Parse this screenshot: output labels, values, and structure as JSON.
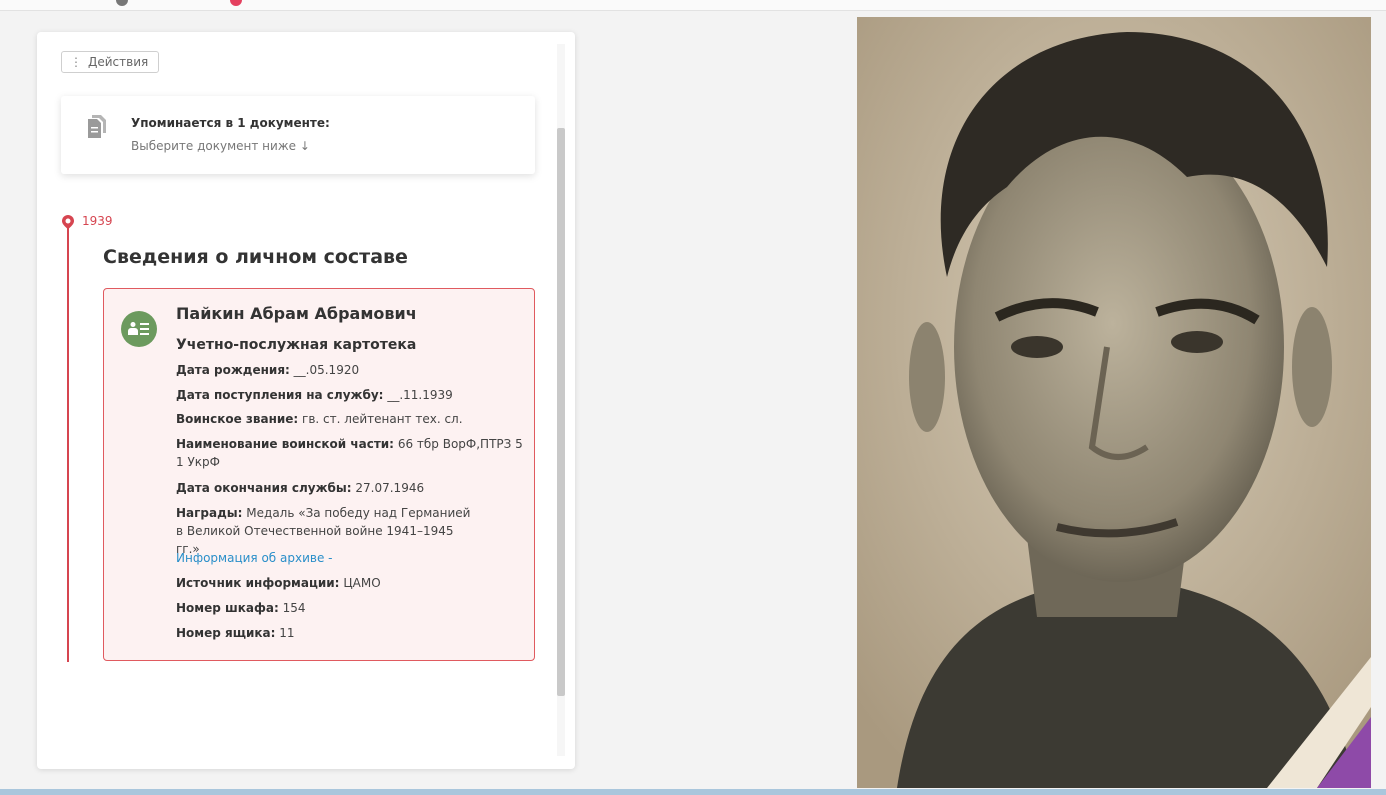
{
  "actions": {
    "label": "Действия"
  },
  "mention": {
    "title": "Упоминается в 1 документе:",
    "hint": "Выберите документ ниже ↓"
  },
  "timeline": {
    "year": "1939"
  },
  "section": {
    "title": "Сведения о личном составе"
  },
  "record": {
    "name": "Пайкин Абрам Абрамович",
    "type": "Учетно-послужная картотека",
    "fields": [
      {
        "label": "Дата рождения:",
        "value": "__.05.1920"
      },
      {
        "label": "Дата поступления на службу:",
        "value": "__.11.1939"
      },
      {
        "label": "Воинское звание:",
        "value": "гв. ст. лейтенант тех. сл."
      },
      {
        "label": "Наименование воинской части:",
        "value": "66 тбр ВорФ,ПТРЗ 5 1 УкрФ"
      },
      {
        "label": "Дата окончания службы:",
        "value": "27.07.1946"
      },
      {
        "label": "Награды:",
        "value": "Медаль «За победу над Германией в Великой Отечественной войне 1941–1945 гг.»"
      }
    ],
    "archive_link": "Информация об архиве -",
    "fields2": [
      {
        "label": "Источник информации:",
        "value": "ЦАМО"
      },
      {
        "label": "Номер шкафа:",
        "value": "154"
      },
      {
        "label": "Номер ящика:",
        "value": "11"
      }
    ]
  },
  "colors": {
    "accent": "#d64550",
    "avatar": "#6c9a5e",
    "link": "#2a8fc9"
  },
  "icons": {
    "document": "documents-icon",
    "avatar": "person-list-icon",
    "pin": "map-pin-icon"
  }
}
